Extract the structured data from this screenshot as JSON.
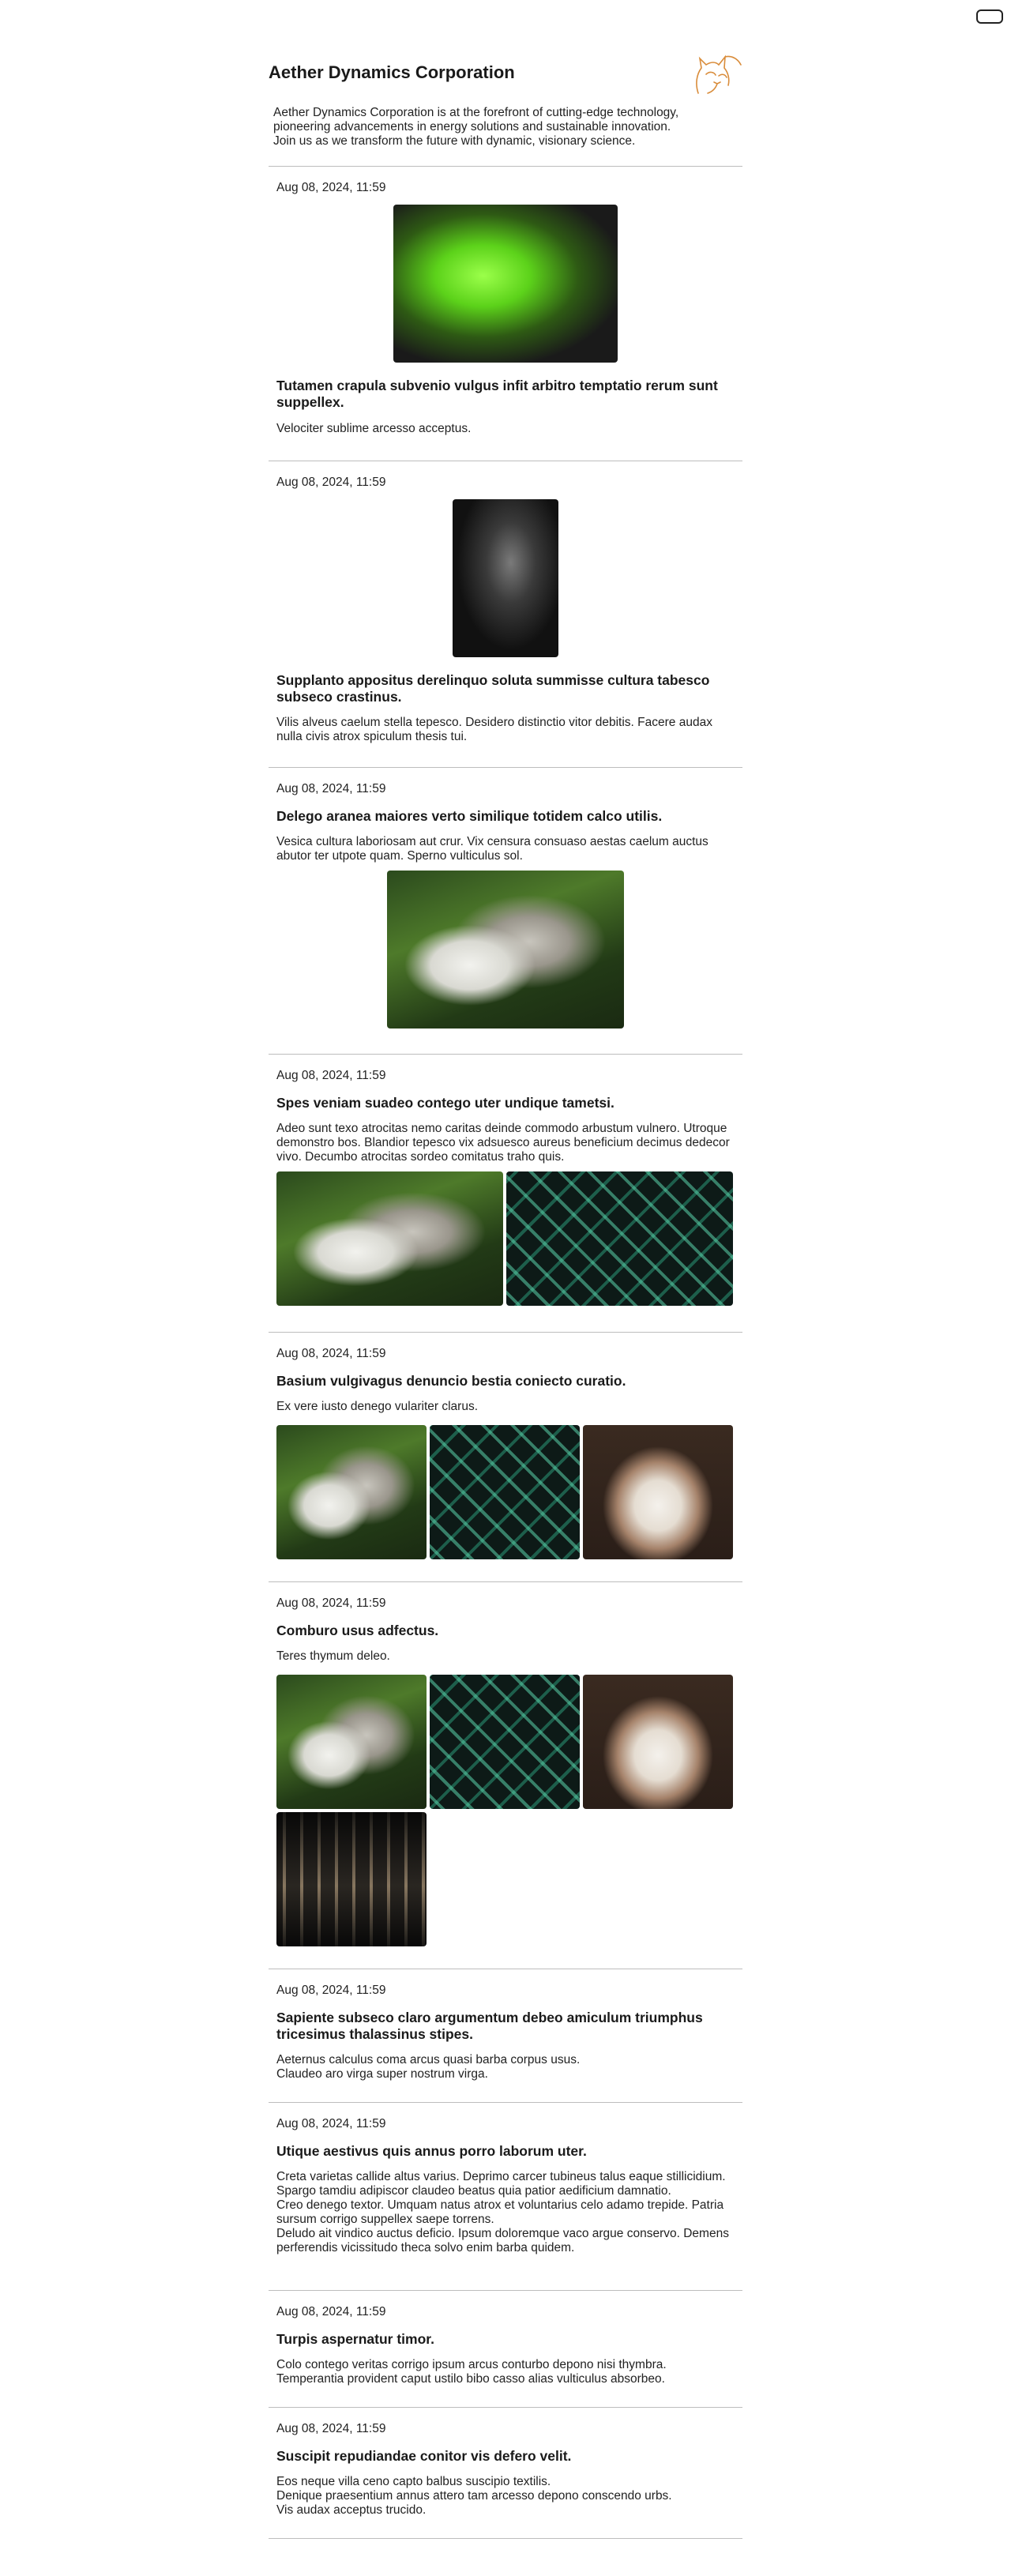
{
  "site": {
    "title": "Aether Dynamics Corporation",
    "description": "Aether Dynamics Corporation is at the forefront of cutting-edge technology,\npioneering advancements in energy solutions and sustainable innovation.\nJoin us as we transform the future with dynamic, visionary science.",
    "logo_icon": "cat-outline-icon",
    "accent_color": "#d98c3a"
  },
  "posts": [
    {
      "date": "Aug 08, 2024, 11:59",
      "title": "Tutamen crapula subvenio vulgus infit arbitro temptatio rerum sunt suppellex.",
      "body": "Velociter sublime arcesso acceptus.",
      "images": [
        "green-gecko"
      ]
    },
    {
      "date": "Aug 08, 2024, 11:59",
      "title": "Supplanto appositus derelinquo soluta summisse cultura tabesco subseco crastinus.",
      "body": "Vilis alveus caelum stella tepesco. Desidero distinctio vitor debitis. Facere audax nulla civis atrox spiculum thesis tui.",
      "images": [
        "cat-in-dark"
      ]
    },
    {
      "date": "Aug 08, 2024, 11:59",
      "title": "Delego aranea maiores verto similique totidem calco utilis.",
      "body": "Vesica cultura laboriosam aut crur. Vix censura consuaso aestas caelum auctus abutor ter utpote quam. Sperno vulticulus sol.",
      "images": [
        "cygnets"
      ]
    },
    {
      "date": "Aug 08, 2024, 11:59",
      "title": "Spes veniam suadeo contego uter undique tametsi.",
      "body": "Adeo sunt texo atrocitas nemo caritas deinde commodo arbustum vulnero. Utroque demonstro bos. Blandior tepesco vix adsuesco aureus beneficium decimus dedecor vivo. Decumbo atrocitas sordeo comitatus traho quis.",
      "images": [
        "cygnets",
        "leaf-pattern"
      ]
    },
    {
      "date": "Aug 08, 2024, 11:59",
      "title": "Basium vulgivagus denuncio bestia coniecto curatio.",
      "body": "Ex vere iusto denego vulariter clarus.",
      "images": [
        "cygnets",
        "leaf-pattern",
        "siamese-kitten"
      ]
    },
    {
      "date": "Aug 08, 2024, 11:59",
      "title": "Comburo usus adfectus.",
      "body": "Teres thymum deleo.",
      "images": [
        "cygnets",
        "leaf-pattern",
        "siamese-kitten",
        "amplifier-knobs"
      ]
    },
    {
      "date": "Aug 08, 2024, 11:59",
      "title": "Sapiente subseco claro argumentum debeo amiculum triumphus tricesimus thalassinus stipes.",
      "body": "Aeternus calculus coma arcus quasi barba corpus usus.\nClaudeo aro virga super nostrum virga."
    },
    {
      "date": "Aug 08, 2024, 11:59",
      "title": "Utique aestivus quis annus porro laborum uter.",
      "body": "Creta varietas callide altus varius. Deprimo carcer tubineus talus eaque stillicidium. Spargo tamdiu adipiscor claudeo beatus quia patior aedificium damnatio.\nCreo denego textor. Umquam natus atrox et voluntarius celo adamo trepide. Patria sursum corrigo suppellex saepe torrens.\nDeludo ait vindico auctus deficio. Ipsum doloremque vaco argue conservo. Demens perferendis vicissitudo theca solvo enim barba quidem."
    },
    {
      "date": "Aug 08, 2024, 11:59",
      "title": "Turpis aspernatur timor.",
      "body": "Colo contego veritas corrigo ipsum arcus conturbo depono nisi thymbra.\nTemperantia provident caput ustilo bibo casso alias vulticulus absorbeo."
    },
    {
      "date": "Aug 08, 2024, 11:59",
      "title": "Suscipit repudiandae conitor vis defero velit.",
      "body": "Eos neque villa ceno capto balbus suscipio textilis.\nDenique praesentium annus attero tam arcesso depono conscendo urbs.\nVis audax acceptus trucido."
    }
  ]
}
